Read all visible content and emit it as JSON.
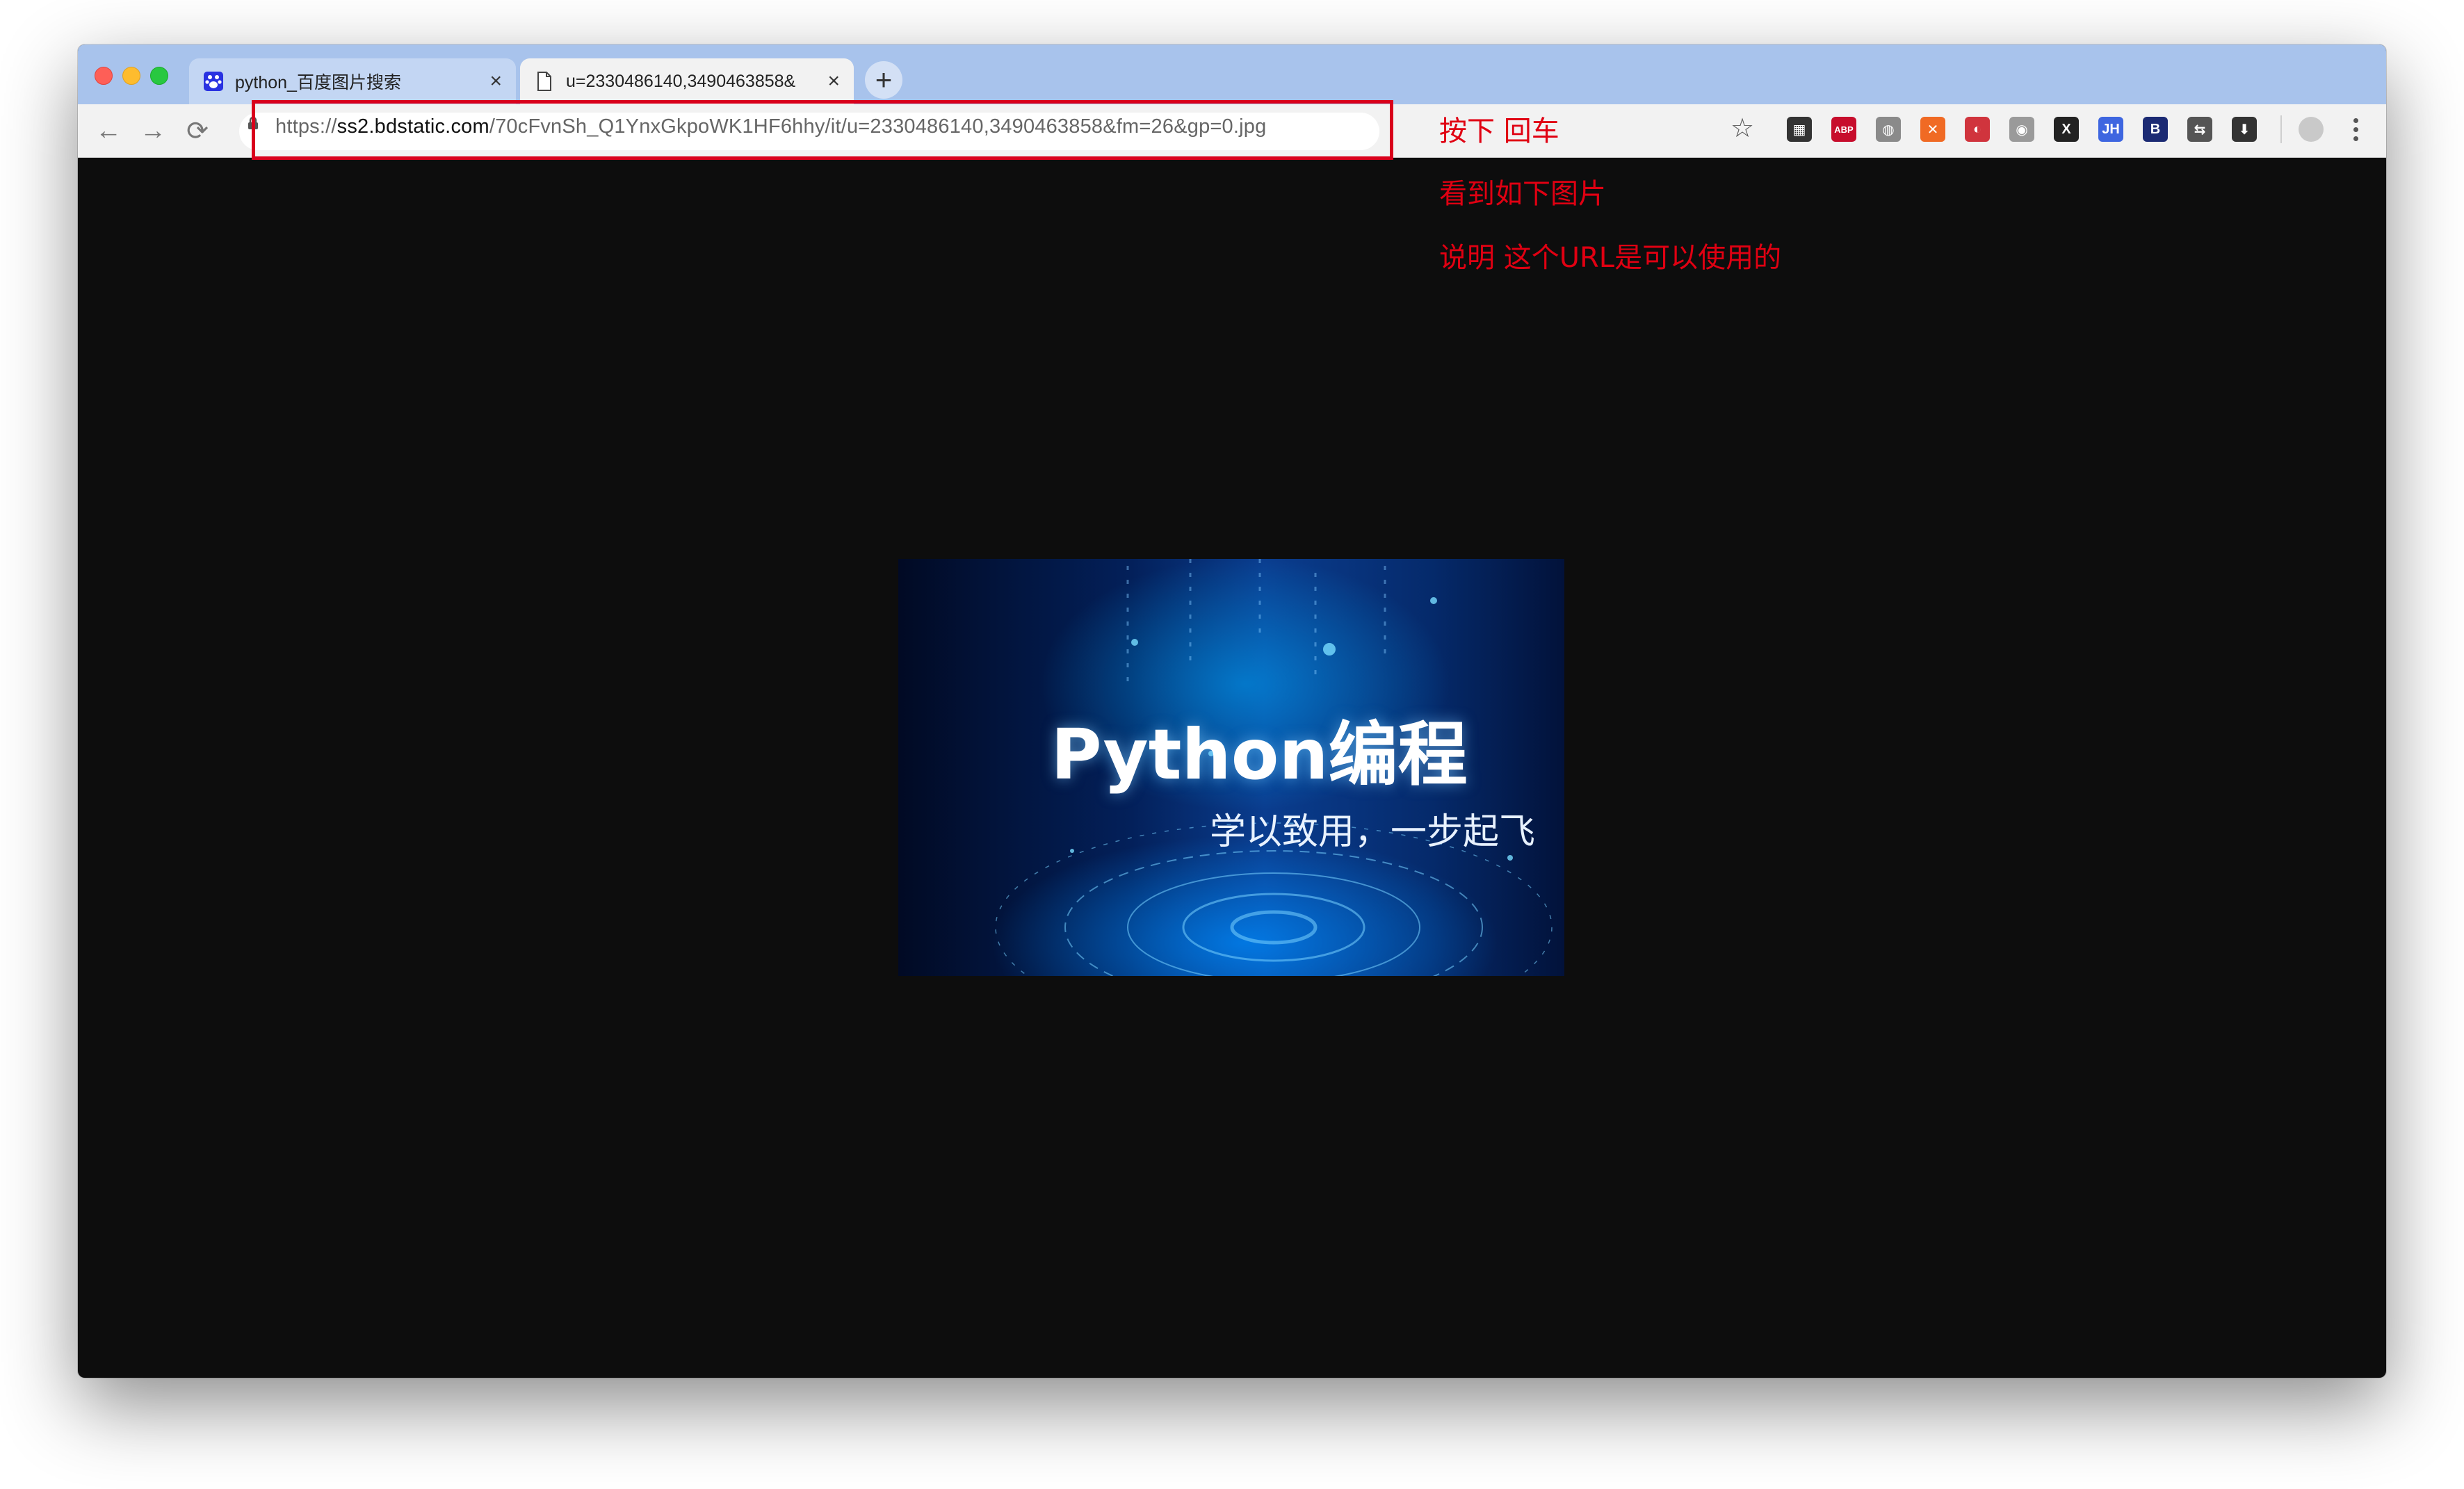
{
  "browser": {
    "tabs": [
      {
        "title": "python_百度图片搜索",
        "active": false,
        "favicon": "baidu-paw-icon"
      },
      {
        "title": "u=2330486140,3490463858&",
        "active": true,
        "favicon": "document-icon"
      }
    ],
    "new_tab_label": "+",
    "close_label": "×",
    "address": {
      "scheme": "https://",
      "host": "ss2.bdstatic.com",
      "path": "/70cFvnSh_Q1YnxGkpoWK1HF6hhy/it/u=2330486140,3490463858&fm=26&gp=0.jpg"
    },
    "nav": {
      "back": "←",
      "forward": "→",
      "reload": "⟳"
    },
    "star": "☆",
    "extensions": [
      {
        "name": "qr-code-icon",
        "label": "▦",
        "color": "#333333"
      },
      {
        "name": "adblock-plus-icon",
        "label": "ABP",
        "color": "#c70d2c"
      },
      {
        "name": "globe-icon",
        "label": "◍",
        "color": "#8a8a8a"
      },
      {
        "name": "orange-x-icon",
        "label": "✕",
        "color": "#f06a24"
      },
      {
        "name": "translate-flag-icon",
        "label": "◐",
        "color": "#d0343d"
      },
      {
        "name": "gray-globe-icon",
        "label": "◉",
        "color": "#9a9a9a"
      },
      {
        "name": "x-square-icon",
        "label": "X",
        "color": "#222222"
      },
      {
        "name": "jh-icon",
        "label": "JH",
        "color": "#3e66e0"
      },
      {
        "name": "b-icon",
        "label": "B",
        "color": "#1b2a73"
      },
      {
        "name": "translate-icon",
        "label": "⇆",
        "color": "#555555"
      },
      {
        "name": "download-icon",
        "label": "⬇",
        "color": "#333333"
      }
    ],
    "accent": "#a8c3ec"
  },
  "annotations": {
    "line1": "按下 回车",
    "line2": "看到如下图片",
    "line3": "说明 这个URL是可以使用的",
    "color": "#e00012"
  },
  "image": {
    "title": "Python编程",
    "subtitle": "学以致用，一步起飞"
  }
}
